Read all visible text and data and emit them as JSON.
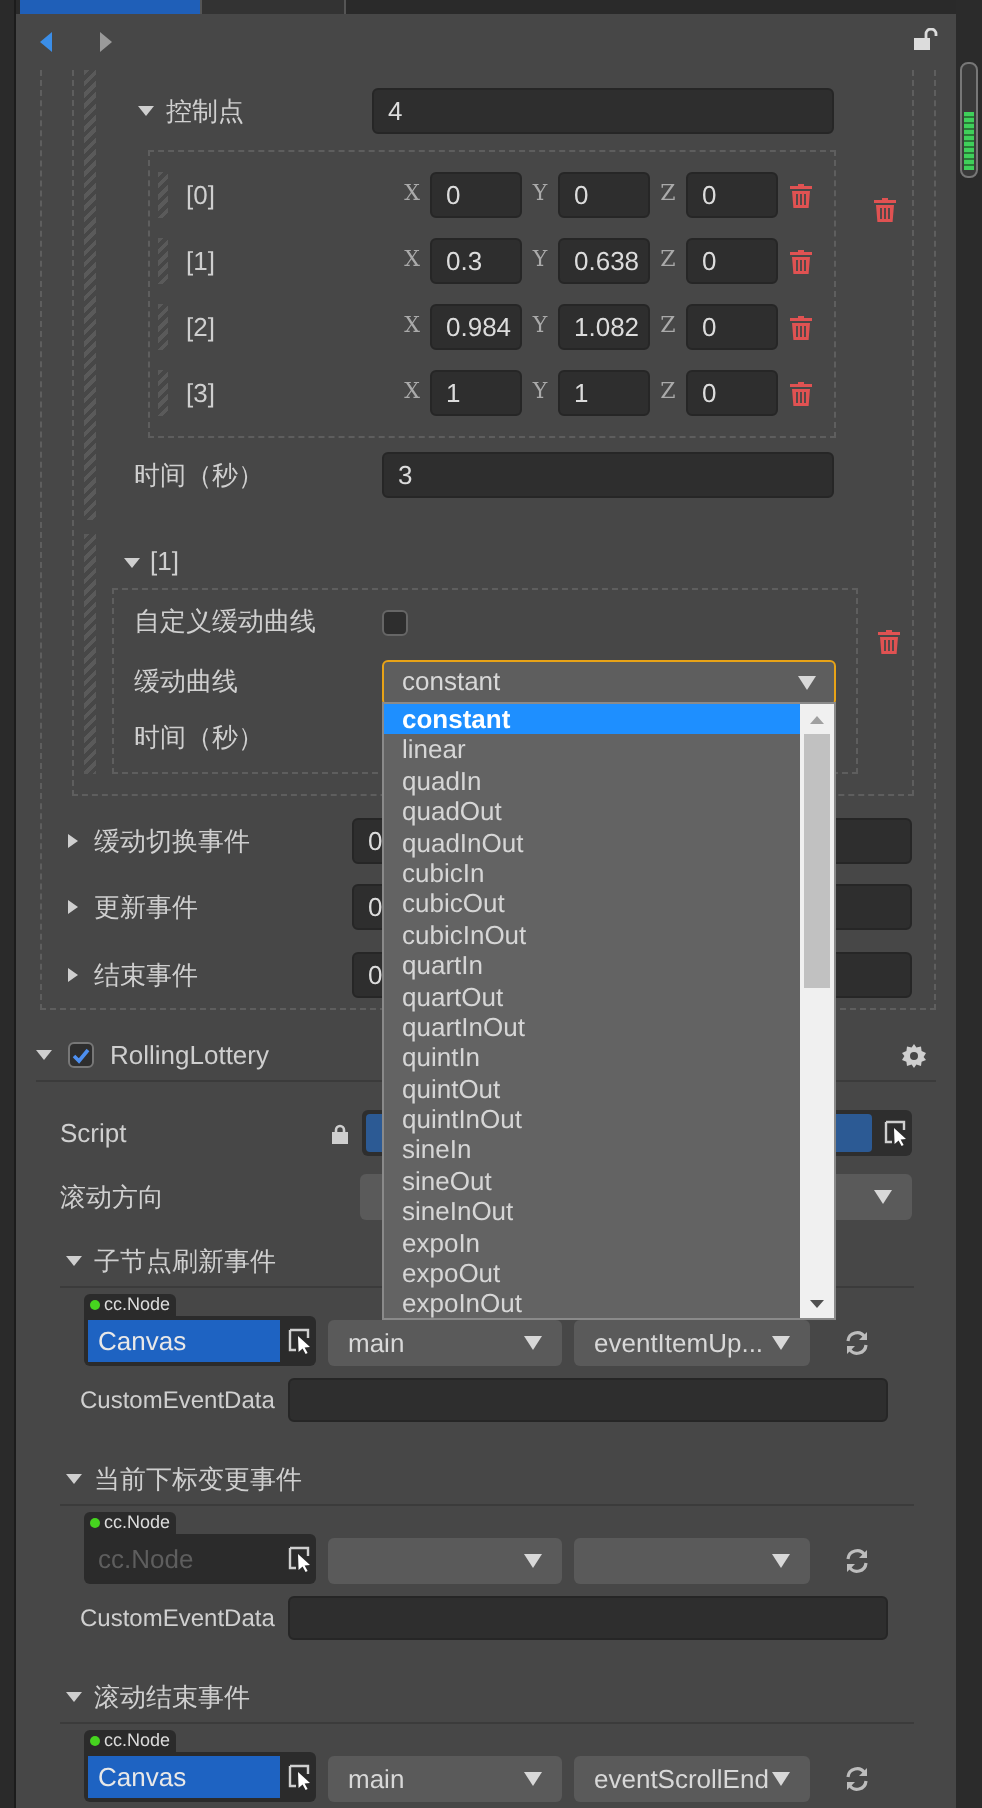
{
  "control_points": {
    "label": "控制点",
    "expanded": true,
    "count": "4",
    "points": [
      {
        "label": "[0]",
        "axes": [
          {
            "label": "X",
            "value": "0"
          },
          {
            "label": "Y",
            "value": "0"
          },
          {
            "label": "Z",
            "value": "0"
          }
        ]
      },
      {
        "label": "[1]",
        "axes": [
          {
            "label": "X",
            "value": "0.3"
          },
          {
            "label": "Y",
            "value": "0.638"
          },
          {
            "label": "Z",
            "value": "0"
          }
        ]
      },
      {
        "label": "[2]",
        "axes": [
          {
            "label": "X",
            "value": "0.984"
          },
          {
            "label": "Y",
            "value": "1.082"
          },
          {
            "label": "Z",
            "value": "0"
          }
        ]
      },
      {
        "label": "[3]",
        "axes": [
          {
            "label": "X",
            "value": "1"
          },
          {
            "label": "Y",
            "value": "1"
          },
          {
            "label": "Z",
            "value": "0"
          }
        ]
      }
    ]
  },
  "duration": {
    "label": "时间（秒）",
    "value": "3"
  },
  "keyframe": {
    "label": "[1]",
    "expanded": true,
    "custom_curve": {
      "label": "自定义缓动曲线",
      "checked": false
    },
    "curve": {
      "label": "缓动曲线",
      "value": "constant"
    },
    "duration_label": "时间（秒）"
  },
  "curve_dropdown": {
    "options": [
      {
        "label": "constant",
        "selected": true
      },
      {
        "label": "linear",
        "selected": false
      },
      {
        "label": "quadIn",
        "selected": false
      },
      {
        "label": "quadOut",
        "selected": false
      },
      {
        "label": "quadInOut",
        "selected": false
      },
      {
        "label": "cubicIn",
        "selected": false
      },
      {
        "label": "cubicOut",
        "selected": false
      },
      {
        "label": "cubicInOut",
        "selected": false
      },
      {
        "label": "quartIn",
        "selected": false
      },
      {
        "label": "quartOut",
        "selected": false
      },
      {
        "label": "quartInOut",
        "selected": false
      },
      {
        "label": "quintIn",
        "selected": false
      },
      {
        "label": "quintOut",
        "selected": false
      },
      {
        "label": "quintInOut",
        "selected": false
      },
      {
        "label": "sineIn",
        "selected": false
      },
      {
        "label": "sineOut",
        "selected": false
      },
      {
        "label": "sineInOut",
        "selected": false
      },
      {
        "label": "expoIn",
        "selected": false
      },
      {
        "label": "expoOut",
        "selected": false
      },
      {
        "label": "expoInOut",
        "selected": false
      }
    ]
  },
  "events": [
    {
      "label": "缓动切换事件",
      "expanded": false,
      "count": "0"
    },
    {
      "label": "更新事件",
      "expanded": false,
      "count": "0"
    },
    {
      "label": "结束事件",
      "expanded": false,
      "count": "0"
    }
  ],
  "component": {
    "title": "RollingLottery",
    "enabled": true,
    "expanded": true
  },
  "script": {
    "label": "Script"
  },
  "direction": {
    "label": "滚动方向"
  },
  "handlers": [
    {
      "label": "子节点刷新事件",
      "expanded": true,
      "tag": "cc.Node",
      "node": "Canvas",
      "component": "main",
      "handler": "eventItemUp...",
      "custom_label": "CustomEventData"
    },
    {
      "label": "当前下标变更事件",
      "expanded": true,
      "tag": "cc.Node",
      "placeholder": "cc.Node",
      "custom_label": "CustomEventData"
    },
    {
      "label": "滚动结束事件",
      "expanded": true,
      "tag": "cc.Node",
      "node": "Canvas",
      "component": "main",
      "handler": "eventScrollEnd"
    }
  ]
}
